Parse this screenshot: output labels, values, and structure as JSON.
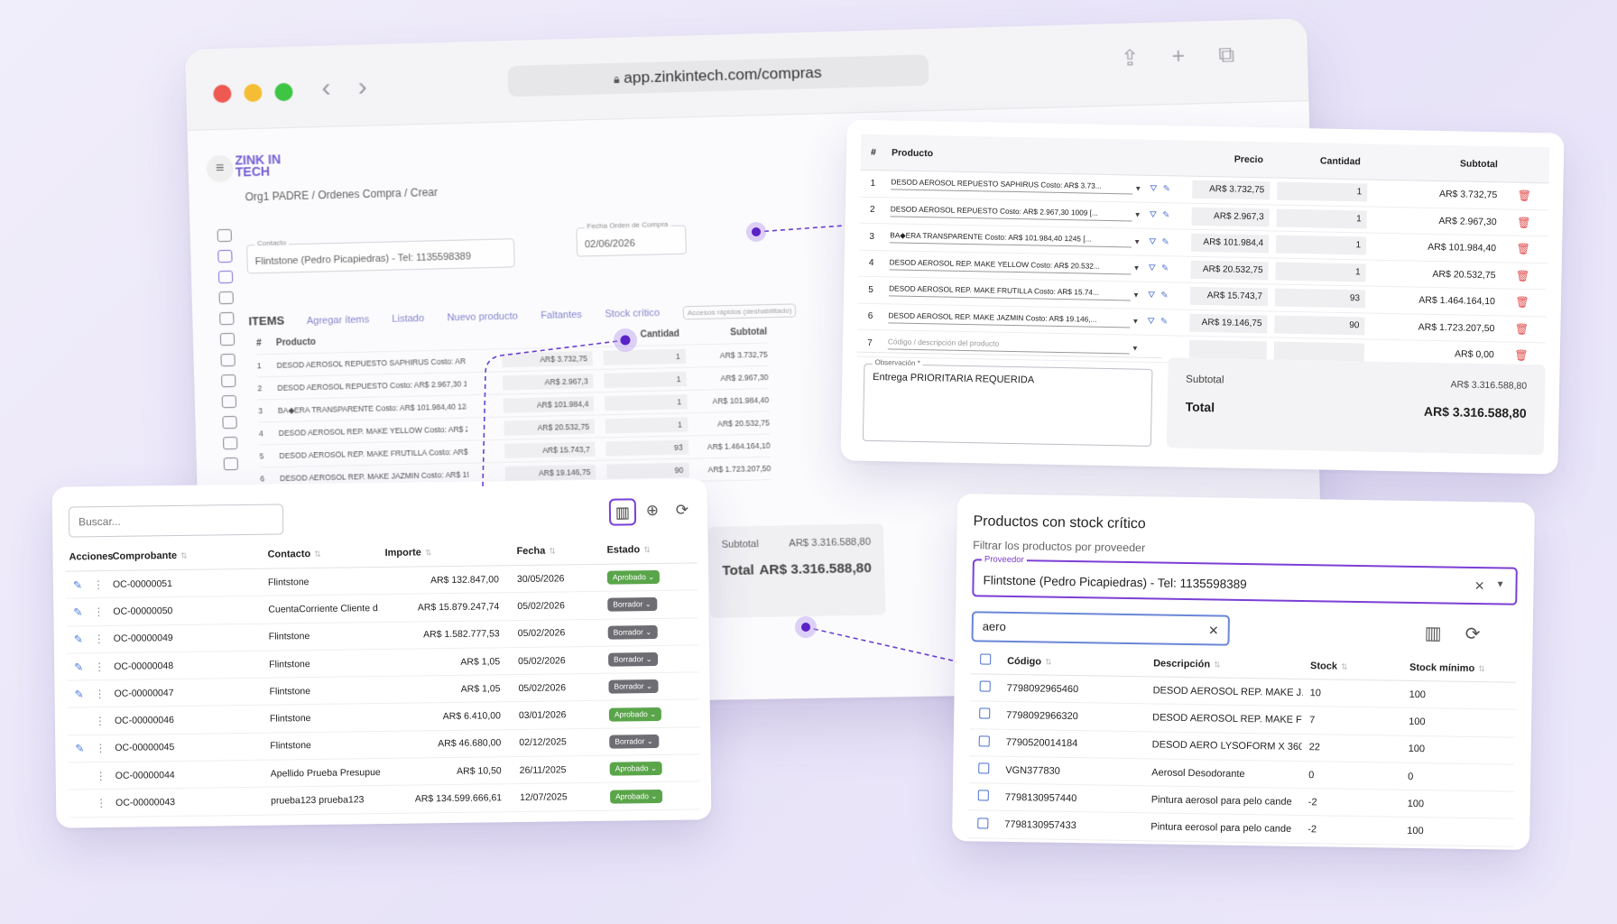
{
  "browser": {
    "url": "app.zinkintech.com/compras",
    "logo_line1": "ZINK IN",
    "logo_line2": "TECH",
    "breadcrumb": "Org1 PADRE  /  Ordenes Compra  /  Crear",
    "contacto_label": "Contacto",
    "contacto_value": "Flintstone (Pedro Picapiedras) - Tel: 1135598389",
    "fecha_label": "Fecha Orden de Compra",
    "fecha_value": "02/06/2026",
    "items_title": "ITEMS",
    "tools": [
      "Agregar ítems",
      "Listado",
      "Nuevo producto",
      "Faltantes",
      "Stock crítico",
      "Accesos rápidos (deshabilitado)"
    ],
    "head_producto": "Producto",
    "head_cantidad": "Cantidad",
    "head_subtotal": "Subtotal",
    "subtotal_label": "Subtotal",
    "subtotal_value": "AR$ 3.316.588,80",
    "total_label": "Total",
    "total_value": "AR$ 3.316.588,80"
  },
  "items": {
    "headers": {
      "num": "#",
      "producto": "Producto",
      "precio": "Precio",
      "cantidad": "Cantidad",
      "subtotal": "Subtotal"
    },
    "rows": [
      {
        "n": "1",
        "desc": "DESOD AEROSOL REPUESTO SAPHIRUS Costo: AR$ 3.73...",
        "precio": "AR$ 3.732,75",
        "cant": "1",
        "sub": "AR$ 3.732,75"
      },
      {
        "n": "2",
        "desc": "DESOD AEROSOL REPUESTO Costo: AR$ 2.967,30 1009 [...",
        "precio": "AR$ 2.967,3",
        "cant": "1",
        "sub": "AR$ 2.967,30"
      },
      {
        "n": "3",
        "desc": "BA◆ERA TRANSPARENTE  Costo: AR$ 101.984,40 1245 [...",
        "precio": "AR$ 101.984,4",
        "cant": "1",
        "sub": "AR$ 101.984,40"
      },
      {
        "n": "4",
        "desc": "DESOD AEROSOL REP. MAKE YELLOW Costo: AR$ 20.532...",
        "precio": "AR$ 20.532,75",
        "cant": "1",
        "sub": "AR$ 20.532,75"
      },
      {
        "n": "5",
        "desc": "DESOD AEROSOL REP. MAKE FRUTILLA Costo: AR$ 15.74...",
        "precio": "AR$ 15.743,7",
        "cant": "93",
        "sub": "AR$ 1.464.164,10"
      },
      {
        "n": "6",
        "desc": "DESOD AEROSOL REP. MAKE JAZMIN Costo: AR$ 19.146,...",
        "precio": "AR$ 19.146,75",
        "cant": "90",
        "sub": "AR$ 1.723.207,50"
      }
    ],
    "new_row": {
      "n": "7",
      "placeholder": "Código / descripción del producto",
      "sub": "AR$ 0,00"
    },
    "observacion_label": "Observación *",
    "observacion_value": "Entrega PRIORITARIA REQUERIDA",
    "subtotal_label": "Subtotal",
    "subtotal_value": "AR$ 3.316.588,80",
    "total_label": "Total",
    "total_value": "AR$ 3.316.588,80"
  },
  "orders": {
    "search_placeholder": "Buscar...",
    "headers": {
      "acciones": "Acciones",
      "comprobante": "Comprobante",
      "contacto": "Contacto",
      "importe": "Importe",
      "fecha": "Fecha",
      "estado": "Estado"
    },
    "rows": [
      {
        "comp": "OC-00000051",
        "contacto": "Flintstone",
        "importe": "AR$ 132.847,00",
        "fecha": "30/05/2026",
        "estado": "Aprobado",
        "editable": true
      },
      {
        "comp": "OC-00000050",
        "contacto": "CuentaCorriente Cliente d",
        "importe": "AR$ 15.879.247,74",
        "fecha": "05/02/2026",
        "estado": "Borrador",
        "editable": true
      },
      {
        "comp": "OC-00000049",
        "contacto": "Flintstone",
        "importe": "AR$ 1.582.777,53",
        "fecha": "05/02/2026",
        "estado": "Borrador",
        "editable": true
      },
      {
        "comp": "OC-00000048",
        "contacto": "Flintstone",
        "importe": "AR$ 1,05",
        "fecha": "05/02/2026",
        "estado": "Borrador",
        "editable": true
      },
      {
        "comp": "OC-00000047",
        "contacto": "Flintstone",
        "importe": "AR$ 1,05",
        "fecha": "05/02/2026",
        "estado": "Borrador",
        "editable": true
      },
      {
        "comp": "OC-00000046",
        "contacto": "Flintstone",
        "importe": "AR$ 6.410,00",
        "fecha": "03/01/2026",
        "estado": "Aprobado",
        "editable": false
      },
      {
        "comp": "OC-00000045",
        "contacto": "Flintstone",
        "importe": "AR$ 46.680,00",
        "fecha": "02/12/2025",
        "estado": "Borrador",
        "editable": true
      },
      {
        "comp": "OC-00000044",
        "contacto": "Apellido Prueba Presupue",
        "importe": "AR$ 10,50",
        "fecha": "26/11/2025",
        "estado": "Aprobado",
        "editable": false
      },
      {
        "comp": "OC-00000043",
        "contacto": "prueba123 prueba123",
        "importe": "AR$ 134.599.666,61",
        "fecha": "12/07/2025",
        "estado": "Aprobado",
        "editable": false
      }
    ]
  },
  "stock": {
    "title": "Productos con stock crítico",
    "subtitle": "Filtrar los productos por proveeder",
    "proveedor_label": "Proveedor",
    "proveedor_value": "Flintstone (Pedro Picapiedras) - Tel: 1135598389",
    "search_value": "aero",
    "headers": {
      "codigo": "Código",
      "descripcion": "Descripción",
      "stock": "Stock",
      "minimo": "Stock mínimo"
    },
    "rows": [
      {
        "codigo": "7798092965460",
        "desc": "DESOD AEROSOL REP. MAKE J...",
        "stock": "10",
        "minimo": "100"
      },
      {
        "codigo": "7798092966320",
        "desc": "DESOD AEROSOL REP. MAKE FI",
        "stock": "7",
        "minimo": "100"
      },
      {
        "codigo": "7790520014184",
        "desc": "DESOD AERO LYSOFORM X 360",
        "stock": "22",
        "minimo": "100"
      },
      {
        "codigo": "VGN377830",
        "desc": "Aerosol Desodorante",
        "stock": "0",
        "minimo": "0"
      },
      {
        "codigo": "7798130957440",
        "desc": "Pintura aerosol para pelo cande",
        "stock": "-2",
        "minimo": "100"
      },
      {
        "codigo": "7798130957433",
        "desc": "Pintura eerosol para pelo cande",
        "stock": "-2",
        "minimo": "100"
      }
    ]
  },
  "colors": {
    "accent": "#7b3fd6",
    "approved": "#5aa54a",
    "draft": "#6d6d73",
    "delete": "#e04646",
    "link": "#4f7ee0"
  },
  "icons": [
    "lock-icon",
    "share-icon",
    "plus-icon",
    "tabs-icon",
    "menu-icon",
    "columns-icon",
    "add-circle-icon",
    "refresh-icon",
    "edit-icon",
    "more-vert-icon",
    "delete-icon",
    "filter-icon",
    "clear-icon",
    "dropdown-icon"
  ]
}
